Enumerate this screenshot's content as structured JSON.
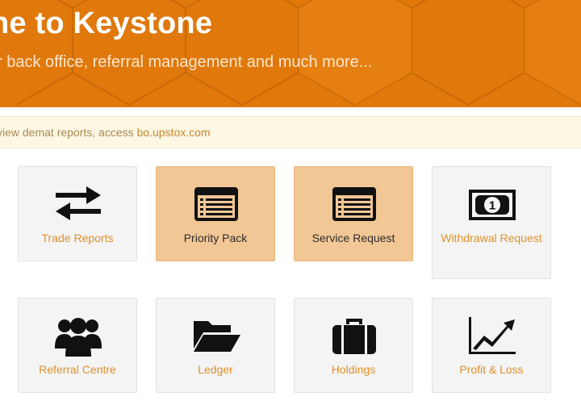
{
  "hero": {
    "title": "ne to Keystone",
    "subtitle": "r back office, referral management and much more..."
  },
  "notice": {
    "text": "view demat reports, access ",
    "link": "bo.upstox.com"
  },
  "tiles": [
    {
      "label": "Trade Reports",
      "icon": "exchange-arrows-icon",
      "highlighted": false
    },
    {
      "label": "Priority Pack",
      "icon": "list-window-icon",
      "highlighted": true
    },
    {
      "label": "Service Request",
      "icon": "list-window-icon",
      "highlighted": true
    },
    {
      "label": "Withdrawal Request",
      "icon": "banknote-icon",
      "highlighted": false
    },
    {
      "label": "Referral Centre",
      "icon": "users-group-icon",
      "highlighted": false
    },
    {
      "label": "Ledger",
      "icon": "folder-open-icon",
      "highlighted": false
    },
    {
      "label": "Holdings",
      "icon": "briefcase-icon",
      "highlighted": false
    },
    {
      "label": "Profit & Loss",
      "icon": "line-chart-icon",
      "highlighted": false
    }
  ],
  "colors": {
    "hero_bg": "#e0780c",
    "accent_text": "#e0902a",
    "highlight_tile": "#f2c796",
    "notice_bg": "#fdf7e4"
  }
}
